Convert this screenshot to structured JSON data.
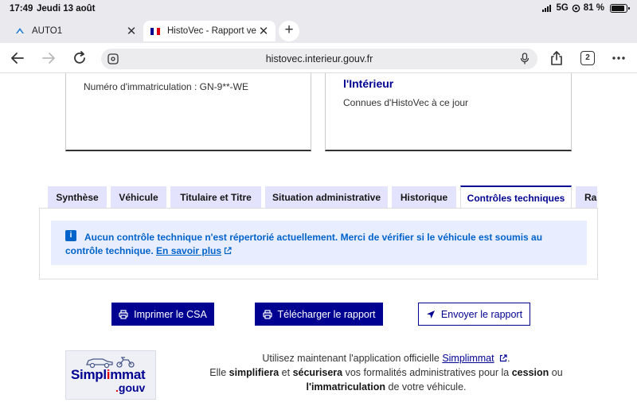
{
  "status": {
    "time": "17:49",
    "date": "Jeudi 13 août",
    "network": "5G",
    "battery": "81 %"
  },
  "tabs": [
    {
      "label": "AUTO1",
      "active": false
    },
    {
      "label": "HistoVec - Rapport vende",
      "active": true
    }
  ],
  "toolbar": {
    "url": "histovec.interieur.gouv.fr",
    "tab_count": "2"
  },
  "cards": {
    "left_text": "Numéro d'immatriculation : GN-9**-WE",
    "right_title": "l'Intérieur",
    "right_sub": "Connues d'HistoVec à ce jour"
  },
  "page_tabs": [
    "Synthèse",
    "Véhicule",
    "Titulaire et Titre",
    "Situation administrative",
    "Historique",
    "Contrôles techniques",
    "Rapport"
  ],
  "notice": {
    "message": "Aucun contrôle technique n'est répertorié actuellement. Merci de vérifier si le véhicule est soumis au contrôle technique.",
    "link": "En savoir plus"
  },
  "buttons": {
    "print": "Imprimer le CSA",
    "download": "Télécharger le rapport",
    "send": "Envoyer le rapport"
  },
  "logo": {
    "word1_a": "Simpl",
    "word1_b": "i",
    "word1_c": "mmat",
    "word2_dot": ".",
    "word2": "gouv"
  },
  "promo": {
    "line1_a": "Utilisez maintenant l'application officielle",
    "line1_link": "Simplimmat",
    "line1_end": ".",
    "line2_a": "Elle",
    "line2_b": "simplifiera",
    "line2_c": "et",
    "line2_d": "sécurisera",
    "line2_e": "vos formalités administratives pour la",
    "line2_f": "cession",
    "line2_g": "ou",
    "line3_a": "l'immatriculation",
    "line3_b": "de votre véhicule."
  },
  "colors": {
    "primary": "#000091",
    "info": "#0063cb",
    "tab_bg": "#e3e3fd",
    "notice_bg": "#e8edff",
    "logo_red": "#e1000f"
  }
}
